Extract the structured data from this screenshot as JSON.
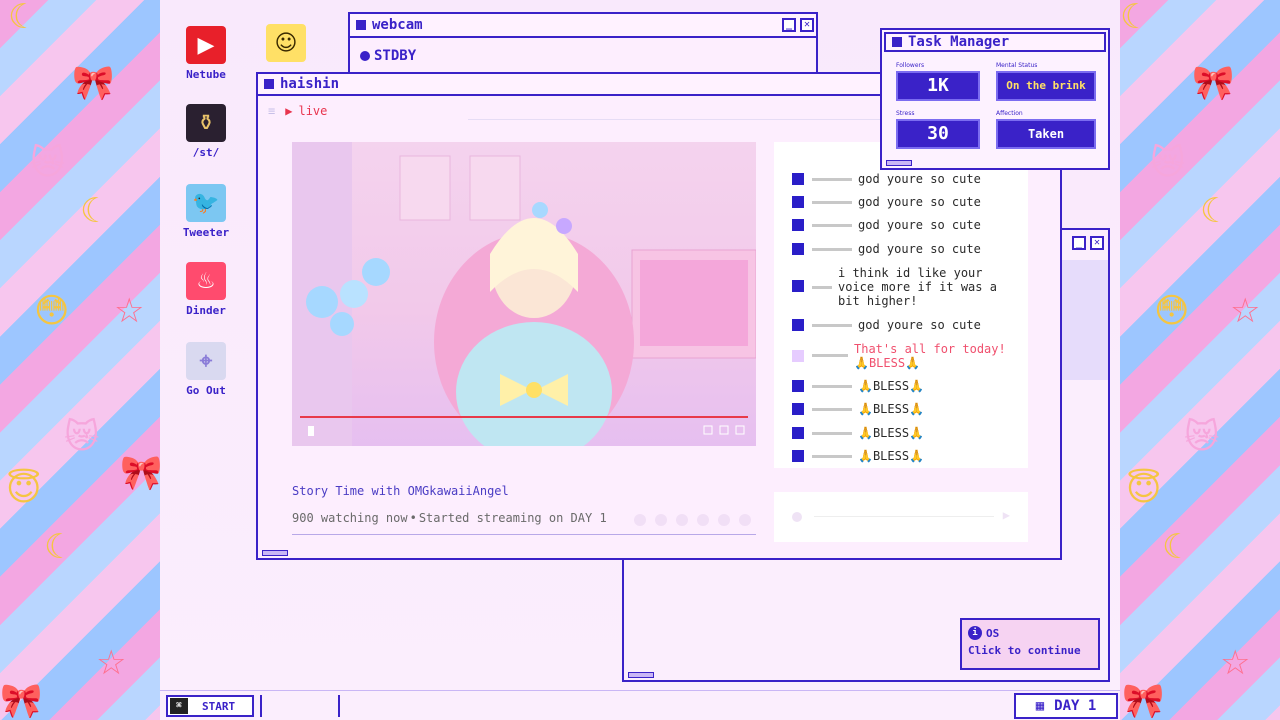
{
  "desktop_icons": [
    {
      "label": "Netube",
      "icon": "play-icon"
    },
    {
      "label": "/st/",
      "icon": "bottle-icon"
    },
    {
      "label": "Tweeter",
      "icon": "bird-icon"
    },
    {
      "label": "Dinder",
      "icon": "flame-icon"
    },
    {
      "label": "Go Out",
      "icon": "map-pin-icon"
    }
  ],
  "webcam": {
    "title": "webcam",
    "status": "STDBY"
  },
  "haishin": {
    "title": "haishin",
    "tab_label": "live",
    "stream_title": "Story Time with OMGkawaiiAngel",
    "watching": "900 watching now",
    "separator": "•",
    "started": "Started streaming on DAY 1"
  },
  "chat": [
    {
      "text": "god youre so cute",
      "type": "viewer"
    },
    {
      "text": "god youre so cute",
      "type": "viewer"
    },
    {
      "text": "god youre so cute",
      "type": "viewer"
    },
    {
      "text": "god youre so cute",
      "type": "viewer"
    },
    {
      "text": "i think id like your voice more if it was a bit higher!",
      "type": "viewer"
    },
    {
      "text": "god youre so cute",
      "type": "viewer"
    },
    {
      "text": "That's all for today!",
      "text2": "🙏BLESS🙏",
      "type": "streamer"
    },
    {
      "text": "🙏BLESS🙏",
      "type": "viewer"
    },
    {
      "text": "🙏BLESS🙏",
      "type": "viewer"
    },
    {
      "text": "🙏BLESS🙏",
      "type": "viewer"
    },
    {
      "text": "🙏BLESS🙏",
      "type": "viewer"
    }
  ],
  "task_manager": {
    "title": "Task Manager",
    "followers_label": "Followers",
    "followers": "1K",
    "mental_label": "Mental Status",
    "mental": "On the brink",
    "stress_label": "Stress",
    "stress": "30",
    "affection_label": "Affection",
    "affection": "Taken"
  },
  "notification": {
    "title": "OS",
    "text": "Click to continue"
  },
  "taskbar": {
    "start": "START",
    "day": "DAY 1"
  },
  "colors": {
    "accent": "#3a22c8",
    "streamer_text": "#f0506e",
    "progress": "#e83a4a"
  }
}
